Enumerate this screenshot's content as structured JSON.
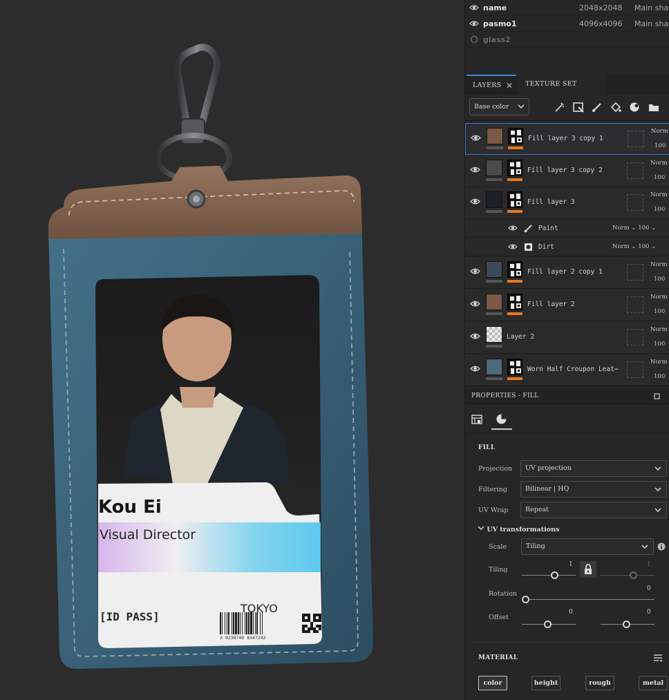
{
  "texture_sets": [
    {
      "name": "name",
      "resolution": "2048x2048",
      "shader": "Main shac",
      "visible": true
    },
    {
      "name": "pasmo1",
      "resolution": "4096x4096",
      "shader": "Main shac",
      "visible": true
    },
    {
      "name": "glass2",
      "resolution": "",
      "shader": "",
      "visible": false
    }
  ],
  "tabs": {
    "layers": "LAYERS",
    "texture_set_settings": "TEXTURE SET SETTINGS"
  },
  "channel_dropdown": "Base color",
  "layers": [
    {
      "name": "Fill layer 3 copy 1",
      "blend": "Norm",
      "opacity": "100",
      "swatch": "#7a5a45",
      "selected": true
    },
    {
      "name": "Fill layer 3 copy 2",
      "blend": "Norm",
      "opacity": "100",
      "swatch": "#4a4a4a",
      "selected": false
    },
    {
      "name": "Fill layer 3",
      "blend": "Norm",
      "opacity": "100",
      "swatch": "#1c1f27",
      "selected": false
    },
    {
      "name": "Fill layer 2 copy 1",
      "blend": "Norm",
      "opacity": "100",
      "swatch": "#3a4a56",
      "selected": false
    },
    {
      "name": "Fill layer 2",
      "blend": "Norm",
      "opacity": "100",
      "swatch": "#7a5a45",
      "selected": false
    },
    {
      "name": "Layer 2",
      "blend": "Norm",
      "opacity": "100",
      "swatch": "checker",
      "selected": false
    },
    {
      "name": "Worn Half Croupon Leat⋯",
      "blend": "Norm",
      "opacity": "100",
      "swatch": "#4d6a78",
      "selected": false
    }
  ],
  "sublayers": [
    {
      "name": "Paint",
      "blend": "Norm",
      "opacity": "100"
    },
    {
      "name": "Dirt",
      "blend": "Norm",
      "opacity": "100"
    }
  ],
  "properties": {
    "header": "PROPERTIES - FILL",
    "fill_title": "FILL",
    "projection_label": "Projection",
    "projection_value": "UV projection",
    "filtering_label": "Filtering",
    "filtering_value": "Bilinear | HQ",
    "uvwrap_label": "UV Wrap",
    "uvwrap_value": "Repeat",
    "uvtrans_title": "UV transformations",
    "scale_label": "Scale",
    "scale_value": "Tiling",
    "tiling_label": "Tiling",
    "tiling_a": "1",
    "tiling_b": "1",
    "rotation_label": "Rotation",
    "rotation_value": "0",
    "offset_label": "Offset",
    "offset_a": "0",
    "offset_b": "0",
    "material_title": "MATERIAL",
    "material_chips": [
      "color",
      "height",
      "rough",
      "metal"
    ]
  },
  "card": {
    "name": "Kou Ei",
    "title": "Visual Director",
    "city": "TOKYO",
    "id_label": "[ID PASS]",
    "barcode_number": "3 9238749 8347242"
  },
  "colors": {
    "accent": "#3d8bd9",
    "mask_bar": "#e8791e",
    "strap": "#7b5f4a",
    "holder": "#3e6478"
  }
}
